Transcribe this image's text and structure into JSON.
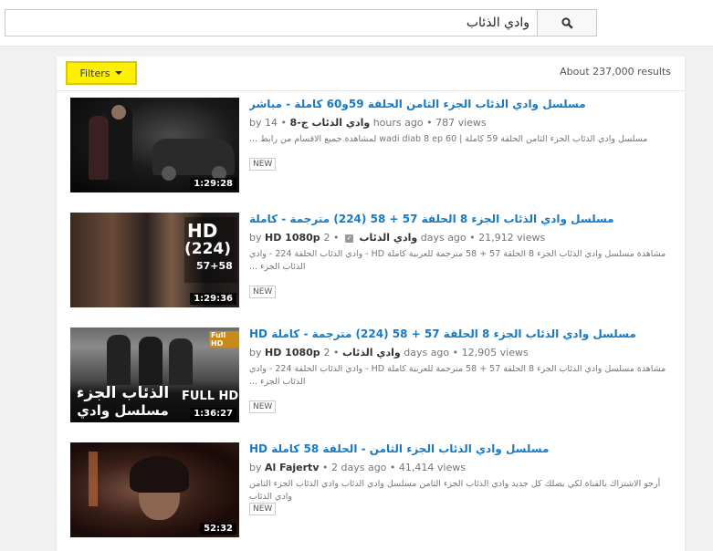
{
  "search": {
    "query": "وادي الذئاب",
    "button_icon": "search-icon"
  },
  "filters": {
    "label": "Filters",
    "highlight_color": "#fff000"
  },
  "results_count": "About 237,000 results",
  "results": [
    {
      "title": "مسلسل وادي الذئاب الجزء الثامن الحلقة 59و60 كاملة - مباشر",
      "by": "by",
      "channel": "وادي الذئاب ج-8",
      "verified": false,
      "age": "14 hours ago",
      "views": "787 views",
      "description": "مسلسل وادي الذئاب الجزء الثامن الحلقة 59 كاملة | wadi diab 8 ep 60 لمشاهدة جميع الاقسام من رابط ...",
      "badge": "NEW",
      "duration": "1:29:28",
      "thumb_overlay": ""
    },
    {
      "title": "مسلسل وادي الذئاب الجزء 8 الحلقة 57 + 58 (224) مترجمة - كاملة",
      "by": "by",
      "channel": "HD 1080p وادي الذئاب",
      "verified": true,
      "age": "2 days ago",
      "views": "21,912 views",
      "description": "مشاهدة مسلسل وادي الذئاب الجزء 8 الحلقة 57 + 58 مترجمة للعربية كاملة HD - وادي الذئاب الحلقة 224 - وادي الذئاب الجزء ...",
      "badge": "NEW",
      "duration": "1:29:36",
      "thumb_overlay": "HD (224) 57+58"
    },
    {
      "title": "مسلسل وادي الذئاب الجزء 8 الحلقة 57 + 58 (224) مترجمة - كاملة HD",
      "by": "by",
      "channel": "HD 1080p وادي الذئاب",
      "verified": false,
      "age": "2 days ago",
      "views": "12,905 views",
      "description": "مشاهدة مسلسل وادي الذئاب الجزء 8 الحلقة 57 + 58 مترجمة للعربية كاملة HD - وادي الذئاب الحلقة 224 - وادي الذئاب الجزء ...",
      "badge": "NEW",
      "duration": "1:36:27",
      "thumb_overlay": "الذئاب الجزء مسلسل وادي FULL HD"
    },
    {
      "title": "مسلسل وادي الذئاب الجزء الثامن - الحلقة 58 كاملة HD",
      "by": "by",
      "channel": "Al Fajertv",
      "verified": false,
      "age": "2 days ago",
      "views": "41,414 views",
      "description": "أرجو الاشتراك بالقناة لكي يصلك كل جديد وادي الذئاب الجزء الثامن مسلسل وادي الذئاب وادي الذئاب الجزء الثامن وادي الذئاب",
      "badge": "NEW",
      "duration": "52:32",
      "thumb_overlay": ""
    }
  ]
}
